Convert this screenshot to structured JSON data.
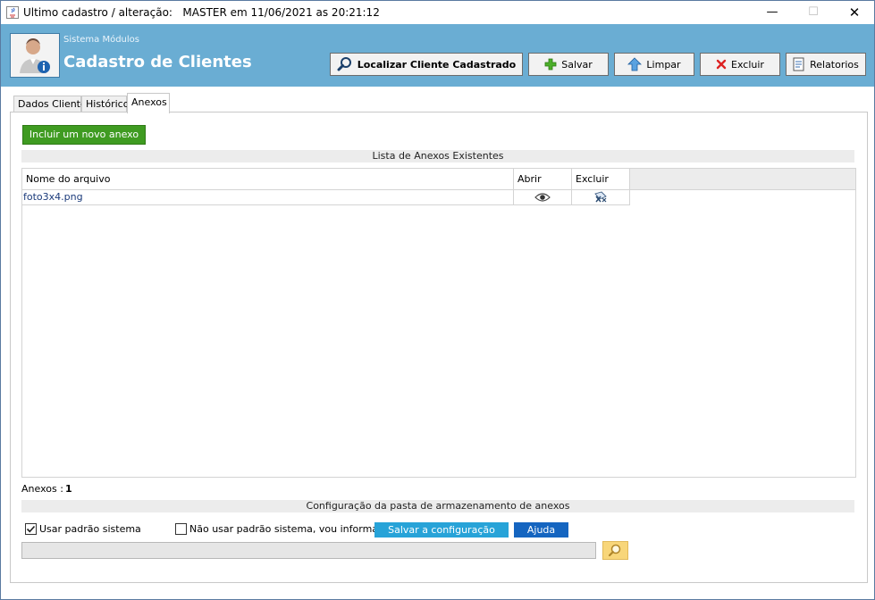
{
  "titlebar": {
    "title": "Ultimo cadastro / alteração:   MASTER em 11/06/2021 as 20:21:12",
    "minimize": "—",
    "maximize": "☐",
    "close": "✕"
  },
  "header": {
    "subtitle": "Sistema Módulos",
    "title": "Cadastro de Clientes",
    "background": "#6aadd3"
  },
  "toolbar": {
    "find_label": "Localizar Cliente Cadastrado",
    "save_label": "Salvar",
    "clear_label": "Limpar",
    "delete_label": "Excluir",
    "reports_label": "Relatorios"
  },
  "tabs": [
    {
      "label": "Dados Cliente"
    },
    {
      "label": "Histórico"
    },
    {
      "label": "Anexos"
    }
  ],
  "attachments": {
    "add_button": "Incluir um novo anexo",
    "list_title": "Lista de Anexos Existentes",
    "columns": {
      "name": "Nome do arquivo",
      "open": "Abrir",
      "delete": "Excluir"
    },
    "rows": [
      {
        "name": "foto3x4.png",
        "open_icon": "eye-icon",
        "delete_icon": "delete-file-icon"
      }
    ],
    "count_label": "Anexos :",
    "count_value": "1"
  },
  "storage_config": {
    "title": "Configuração da pasta de armazenamento de anexos",
    "use_default_label": "Usar padrão sistema",
    "use_default_checked": true,
    "custom_label": "Não usar padrão sistema, vou informar",
    "custom_checked": false,
    "save_button": "Salvar a configuração",
    "help_button": "Ajuda",
    "path_value": ""
  },
  "colors": {
    "accent_green": "#3f9b21",
    "save_config_blue": "#27a3d8",
    "help_blue": "#1565c0",
    "search_yellow": "#f8d67a",
    "link_text": "#1a3a7a"
  }
}
